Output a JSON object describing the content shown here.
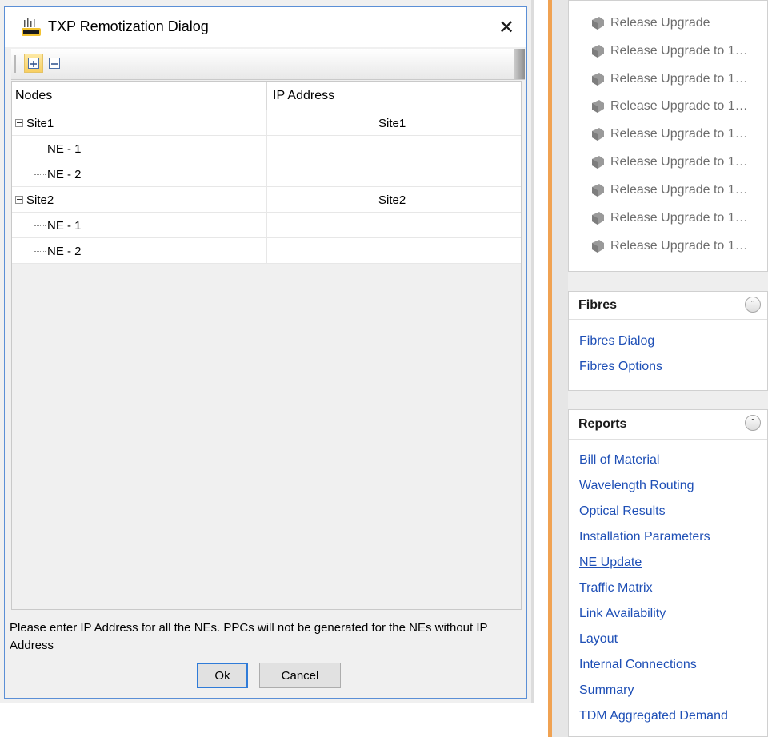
{
  "dialog": {
    "title": "TXP Remotization Dialog",
    "close_glyph": "✕",
    "columns": {
      "nodes": "Nodes",
      "ip": "IP Address"
    },
    "rows": [
      {
        "node": "Site1",
        "ip": "Site1",
        "level": 0
      },
      {
        "node": "NE - 1",
        "ip": "",
        "level": 1
      },
      {
        "node": "NE - 2",
        "ip": "",
        "level": 1
      },
      {
        "node": "Site2",
        "ip": "Site2",
        "level": 0
      },
      {
        "node": "NE - 1",
        "ip": "",
        "level": 1
      },
      {
        "node": "NE - 2",
        "ip": "",
        "level": 1
      }
    ],
    "message": "Please enter IP Address for all the NEs. PPCs will not be generated for the NEs without IP Address",
    "ok_label": "Ok",
    "cancel_label": "Cancel"
  },
  "release": {
    "items": [
      "Release Upgrade",
      "Release Upgrade to 1…",
      "Release Upgrade to 1…",
      "Release Upgrade to 1…",
      "Release Upgrade to 1…",
      "Release Upgrade to 1…",
      "Release Upgrade to 1…",
      "Release Upgrade to 1…",
      "Release Upgrade to 1…"
    ]
  },
  "fibres": {
    "title": "Fibres",
    "links": [
      "Fibres Dialog",
      "Fibres Options"
    ]
  },
  "reports": {
    "title": "Reports",
    "links": [
      "Bill of Material",
      "Wavelength Routing",
      "Optical Results",
      "Installation Parameters",
      "NE Update",
      "Traffic Matrix",
      "Link Availability",
      "Layout",
      "Internal Connections",
      "Summary",
      "TDM Aggregated Demand"
    ]
  },
  "colors": {
    "link": "#1e4fb6",
    "accent_orange": "#f0a252",
    "dialog_border": "#5b8fd6"
  },
  "icons": {
    "gear": "gear-icon",
    "expand_all": "expand-all-icon",
    "collapse_all": "collapse-all-icon",
    "collapse_section": "double-chevron-up-icon"
  }
}
